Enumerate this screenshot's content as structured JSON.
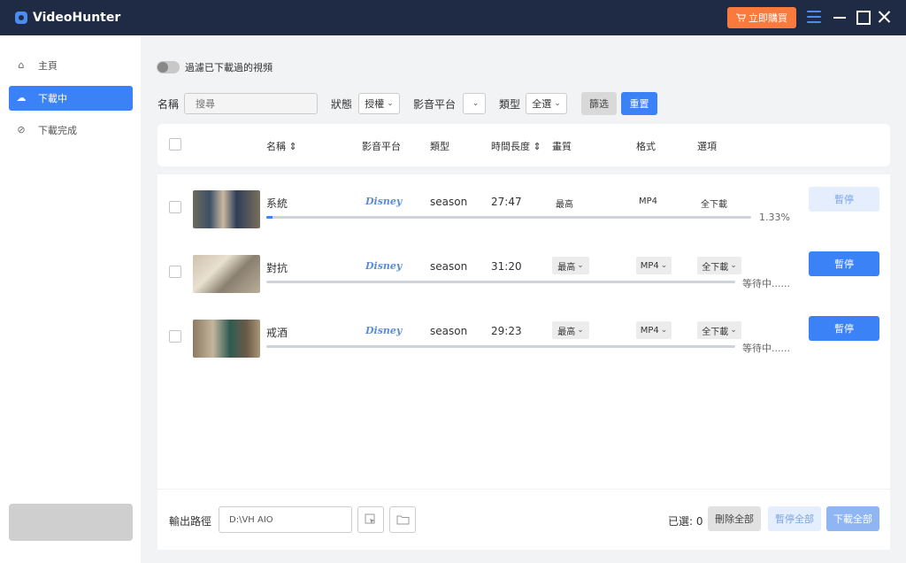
{
  "app": {
    "title": "VideoHunter",
    "buy_label": "立即購買"
  },
  "sidebar": {
    "items": [
      {
        "label": "主頁"
      },
      {
        "label": "下載中"
      },
      {
        "label": "下載完成"
      }
    ]
  },
  "toolbar": {
    "toggle_label": "過濾已下載過的視頻",
    "name_label": "名稱",
    "search_placeholder": "搜尋",
    "status_label": "狀態",
    "status_value": "授權",
    "platform_label": "影音平台",
    "platform_value": "",
    "type_label": "類型",
    "type_value": "全選",
    "filter_button": "篩选",
    "reset_button": "重置"
  },
  "table": {
    "headers": {
      "name": "名稱",
      "platform": "影音平台",
      "type": "類型",
      "duration": "時間長度",
      "quality": "畫質",
      "format": "格式",
      "options": "選項"
    },
    "rows": [
      {
        "title": "系統",
        "platform": "Disney",
        "type": "season",
        "duration": "27:47",
        "quality": "最高",
        "format": "MP4",
        "option": "全下載",
        "progress_text": "1.33%",
        "progress": 1.33,
        "action": "暫停"
      },
      {
        "title": "對抗",
        "platform": "Disney",
        "type": "season",
        "duration": "31:20",
        "quality": "最高",
        "format": "MP4",
        "option": "全下載",
        "progress_text": "等待中......",
        "progress": 0,
        "action": "暫停"
      },
      {
        "title": "戒酒",
        "platform": "Disney",
        "type": "season",
        "duration": "29:23",
        "quality": "最高",
        "format": "MP4",
        "option": "全下載",
        "progress_text": "等待中......",
        "progress": 0,
        "action": "暫停"
      }
    ]
  },
  "footer": {
    "output_label": "輸出路徑",
    "output_path": "D:\\VH AIO",
    "selected_label": "已選: 0",
    "delete_all": "刪除全部",
    "pause_all": "暫停全部",
    "download_all": "下載全部"
  },
  "colors": {
    "accent": "#3b82f6",
    "titlebar": "#1f2b44",
    "buy": "#f97a3c"
  }
}
